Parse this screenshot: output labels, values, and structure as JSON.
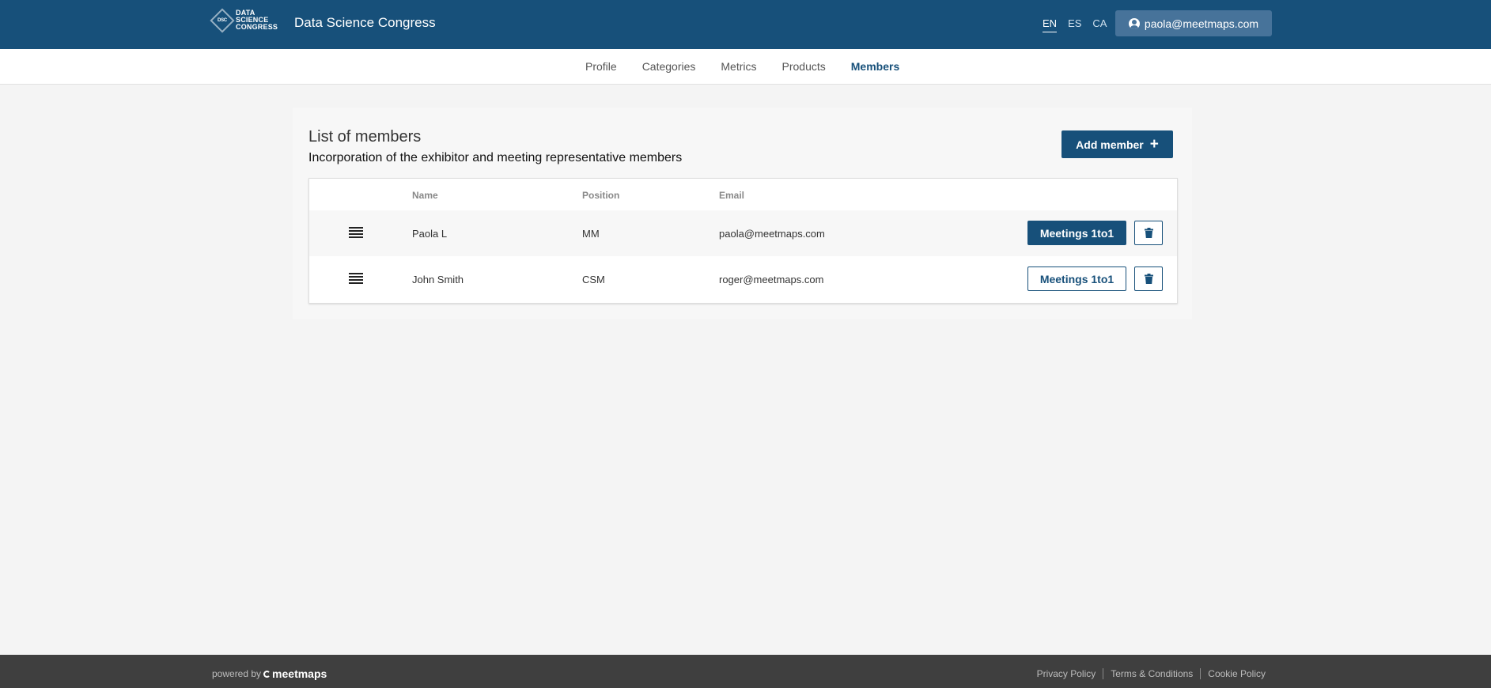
{
  "header": {
    "logo_mark": "DSC",
    "logo_lines": [
      "DATA",
      "SCIENCE",
      "CONGRESS"
    ],
    "title": "Data Science Congress",
    "languages": [
      "EN",
      "ES",
      "CA"
    ],
    "active_language": "EN",
    "user_email": "paola@meetmaps.com",
    "user_icon": "account-circle-icon",
    "bg_color": "#17507a"
  },
  "tabs": [
    {
      "label": "Profile",
      "active": false
    },
    {
      "label": "Categories",
      "active": false
    },
    {
      "label": "Metrics",
      "active": false
    },
    {
      "label": "Products",
      "active": false
    },
    {
      "label": "Members",
      "active": true
    }
  ],
  "members": {
    "title": "List of members",
    "subtitle": "Incorporation of the exhibitor and meeting representative members",
    "add_button": "Add member",
    "add_icon": "plus-icon",
    "columns": {
      "name": "Name",
      "position": "Position",
      "email": "Email"
    },
    "rows": [
      {
        "name": "Paola L",
        "position": "MM",
        "email": "paola@meetmaps.com",
        "meetings_label": "Meetings 1to1",
        "meetings_style": "primary"
      },
      {
        "name": "John Smith",
        "position": "CSM",
        "email": "roger@meetmaps.com",
        "meetings_label": "Meetings 1to1",
        "meetings_style": "outline"
      }
    ]
  },
  "footer": {
    "powered_by": "powered by",
    "brand": "meetmaps",
    "links": [
      "Privacy Policy",
      "Terms & Conditions",
      "Cookie Policy"
    ]
  }
}
